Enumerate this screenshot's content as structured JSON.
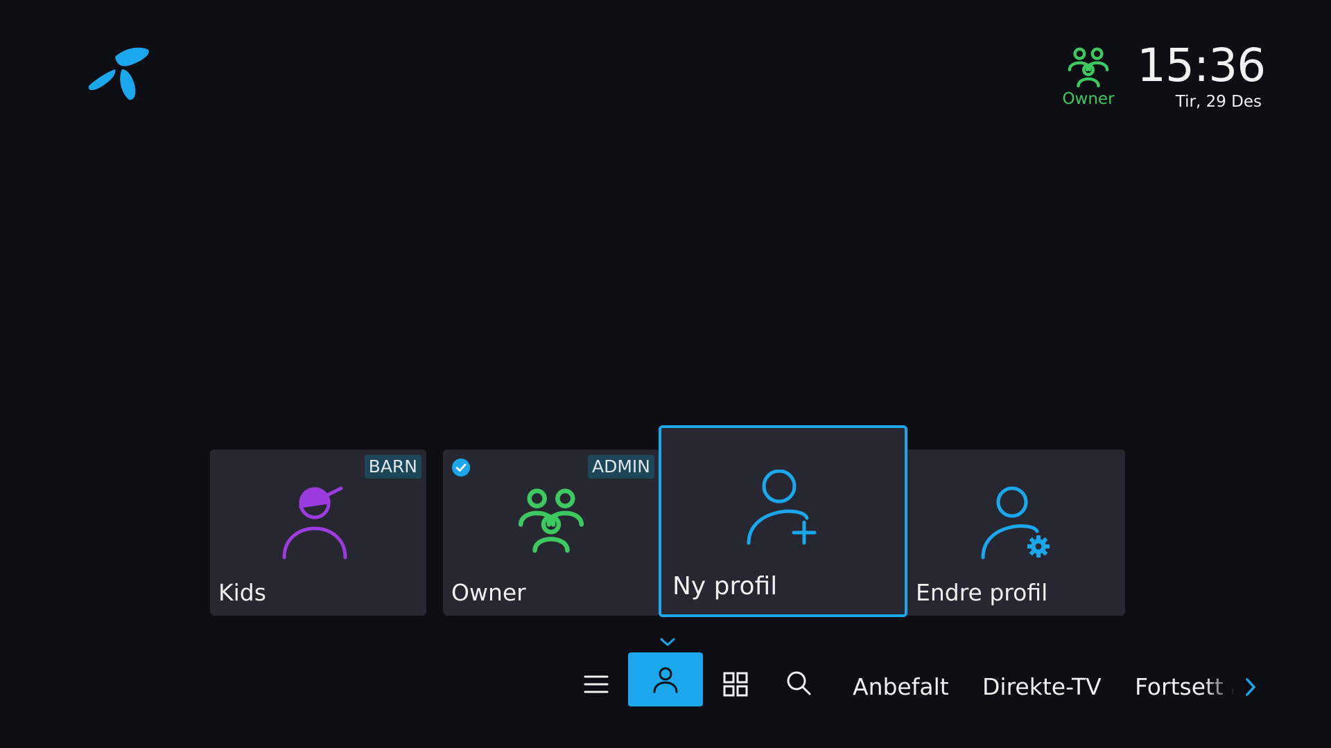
{
  "header": {
    "logo": "telenor-logo",
    "active_profile": {
      "name": "Owner",
      "icon": "group-icon",
      "color": "#3ec860"
    },
    "time": "15:36",
    "date": "Tir, 29 Des"
  },
  "profiles": [
    {
      "name": "Kids",
      "badge": "BARN",
      "icon": "kid-cap-icon",
      "color": "#9b3be0",
      "selected": false
    },
    {
      "name": "Owner",
      "badge": "ADMIN",
      "icon": "group-icon",
      "color": "#3ec860",
      "selected": true
    },
    {
      "name": "Ny profil",
      "icon": "add-user-icon",
      "color": "#1ba7ec",
      "focused": true
    },
    {
      "name": "Endre profil",
      "icon": "user-settings-icon",
      "color": "#1ba7ec"
    }
  ],
  "nav": {
    "items": [
      {
        "icon": "menu-icon"
      },
      {
        "icon": "user-icon",
        "active": true
      },
      {
        "icon": "grid-icon"
      },
      {
        "icon": "search-icon"
      },
      {
        "label": "Anbefalt"
      },
      {
        "label": "Direkte-TV"
      },
      {
        "label": "Fortsett å"
      }
    ],
    "more_icon": "chevron-right-icon"
  },
  "colors": {
    "accent": "#1ba7ec",
    "background": "#0c0e13",
    "tile": "#262730"
  }
}
